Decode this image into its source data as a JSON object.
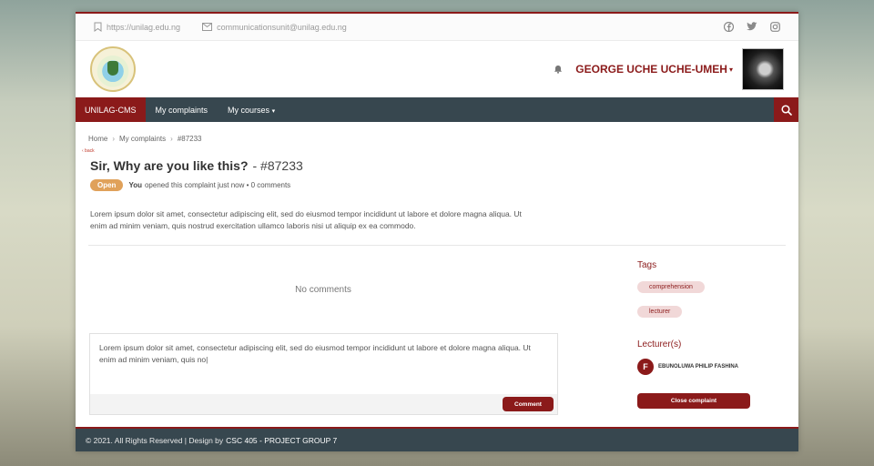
{
  "topbar": {
    "website": "https://unilag.edu.ng",
    "email": "communicationsunit@unilag.edu.ng",
    "socials": [
      "facebook-icon",
      "twitter-icon",
      "instagram-icon"
    ]
  },
  "header": {
    "username": "GEORGE UCHE UCHE-UMEH",
    "caret": "▾"
  },
  "nav": {
    "brand": "UNILAG-CMS",
    "links": [
      "My complaints",
      "My courses"
    ],
    "courses_caret": "▾"
  },
  "breadcrumb": {
    "items": [
      "Home",
      "My complaints",
      "#87233"
    ],
    "sep": "›"
  },
  "back_link": "‹ back",
  "complaint": {
    "title": "Sir, Why are you like this?",
    "ticket": "- #87233",
    "status": "Open",
    "author": "You",
    "meta": "opened this complaint just now • 0 comments",
    "description": "Lorem ipsum dolor sit amet, consectetur adipiscing elit, sed do eiusmod tempor incididunt ut labore et dolore magna aliqua. Ut enim ad minim veniam, quis nostrud exercitation ullamco laboris nisi ut aliquip ex ea commodo."
  },
  "comments": {
    "empty_text": "No comments",
    "draft": "Lorem ipsum dolor sit amet, consectetur adipiscing elit, sed do eiusmod tempor incididunt ut labore et dolore magna aliqua. Ut enim ad minim veniam, quis no|",
    "submit_label": "Comment"
  },
  "sidebar": {
    "tags_heading": "Tags",
    "tags": [
      "comprehension",
      "lecturer"
    ],
    "lecturers_heading": "Lecturer(s)",
    "lecturer": {
      "initial": "F",
      "name": "EBUNOLUWA PHILIP FASHINA"
    },
    "close_label": "Close complaint"
  },
  "footer": {
    "copyright": "© 2021. All Rights Reserved | Design by",
    "credit": "CSC 405 - PROJECT GROUP 7"
  },
  "colors": {
    "brand": "#8b1a1a",
    "nav": "#37474f",
    "open_badge": "#e0a15a"
  }
}
